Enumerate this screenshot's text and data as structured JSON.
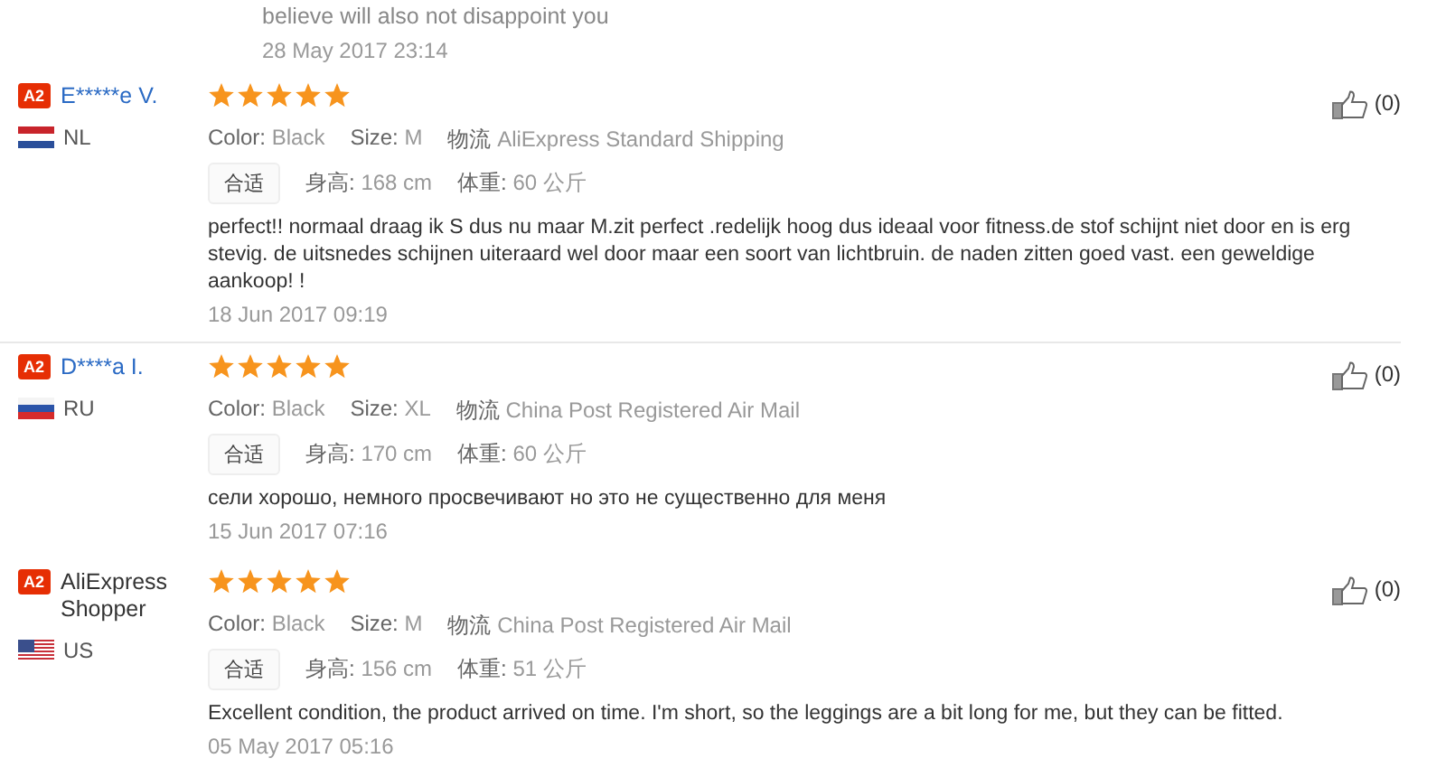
{
  "previous_reply": {
    "text": "believe will also not disappoint you",
    "date": "28 May 2017 23:14"
  },
  "reviews": [
    {
      "badge": "A2",
      "name": "E*****e V.",
      "linked": true,
      "flag": {
        "kind": "nl"
      },
      "country": "NL",
      "stars": 5,
      "attributes": [
        {
          "label": "Color:",
          "value": "Black"
        },
        {
          "label": "Size:",
          "value": "M"
        },
        {
          "label": "物流",
          "value": "AliExpress Standard Shipping"
        }
      ],
      "fit_tag": "合适",
      "measures": [
        {
          "label": "身高:",
          "value": "168 cm"
        },
        {
          "label": "体重:",
          "value": "60 公斤"
        }
      ],
      "comment": "perfect!! normaal draag ik S dus nu maar M.zit perfect .redelijk hoog dus ideaal voor fitness.de stof schijnt niet door en is erg stevig. de uitsnedes schijnen uiteraard wel door maar een soort van lichtbruin. de naden zitten goed vast. een geweldige aankoop! !",
      "date": "18 Jun 2017 09:19",
      "helpful": "(0)",
      "divider": true
    },
    {
      "badge": "A2",
      "name": "D****a I.",
      "linked": true,
      "flag": {
        "kind": "ru"
      },
      "country": "RU",
      "stars": 5,
      "attributes": [
        {
          "label": "Color:",
          "value": "Black"
        },
        {
          "label": "Size:",
          "value": "XL"
        },
        {
          "label": "物流",
          "value": "China Post Registered Air Mail"
        }
      ],
      "fit_tag": "合适",
      "measures": [
        {
          "label": "身高:",
          "value": "170 cm"
        },
        {
          "label": "体重:",
          "value": "60 公斤"
        }
      ],
      "comment": "сели хорошо, немного просвечивают но это не существенно для меня",
      "date": "15 Jun 2017 07:16",
      "helpful": "(0)",
      "divider": false
    },
    {
      "badge": "A2",
      "name": "AliExpress Shopper",
      "linked": false,
      "flag": {
        "kind": "us"
      },
      "country": "US",
      "stars": 5,
      "attributes": [
        {
          "label": "Color:",
          "value": "Black"
        },
        {
          "label": "Size:",
          "value": "M"
        },
        {
          "label": "物流",
          "value": "China Post Registered Air Mail"
        }
      ],
      "fit_tag": "合适",
      "measures": [
        {
          "label": "身高:",
          "value": "156 cm"
        },
        {
          "label": "体重:",
          "value": "51 公斤"
        }
      ],
      "comment": "Excellent condition, the product arrived on time. I'm short, so the leggings are a bit long for me, but they can be fitted.",
      "date": "05 May 2017 05:16",
      "helpful": "(0)",
      "divider": false
    }
  ]
}
